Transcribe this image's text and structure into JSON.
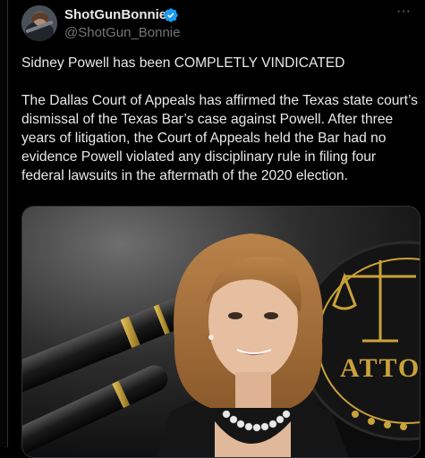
{
  "post": {
    "display_name": "ShotGunBonnie",
    "handle": "@ShotGun_Bonnie",
    "verified_icon": "verified-badge-icon",
    "avatar_icon": "avatar-image",
    "more_icon": "more-options-icon",
    "text_line1": "Sidney Powell has been  COMPLETLY VINDICATED",
    "text_paragraph2": "The Dallas Court of Appeals has affirmed the Texas state court’s dismissal of the Texas Bar’s case against Powell. After three years of litigation, the Court of Appeals held the Bar had no evidence Powell violated any disciplinary rule in filing four federal lawsuits in the aftermath of the 2020 election.",
    "media": {
      "badge_text": "ATTOR"
    }
  },
  "colors": {
    "background": "#000000",
    "text": "#e7e9ea",
    "secondary": "#71767b",
    "verified": "#1d9bf0",
    "gold": "#c9a23a"
  }
}
